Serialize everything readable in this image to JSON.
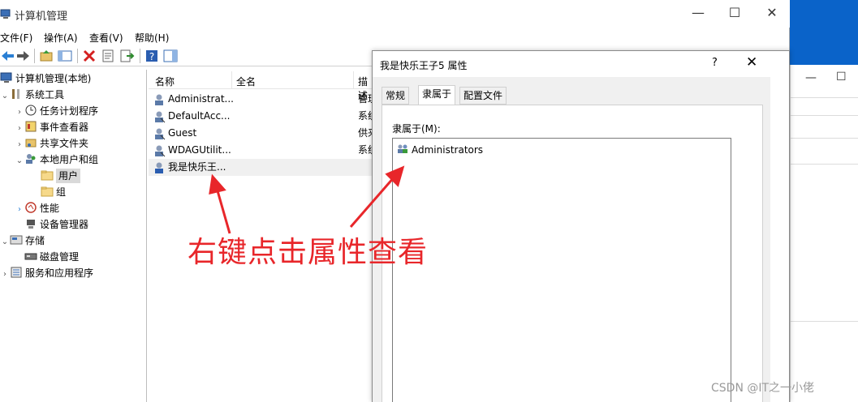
{
  "window": {
    "title": "计算机管理",
    "controls": {
      "minimize": "—",
      "maximize": "☐",
      "close": "✕"
    }
  },
  "menu": [
    "文件(F)",
    "操作(A)",
    "查看(V)",
    "帮助(H)"
  ],
  "toolbar_icons": [
    "back-icon",
    "forward-icon",
    "up-folder-icon",
    "show-hide-tree-icon",
    "delete-icon",
    "properties-icon",
    "export-icon",
    "help-icon",
    "action-pane-icon"
  ],
  "tree": [
    {
      "label": "计算机管理(本地)",
      "icon": "computer-management-icon",
      "expand": "",
      "level": 0
    },
    {
      "label": "系统工具",
      "icon": "system-tools-icon",
      "expand": "⌄",
      "level": 1
    },
    {
      "label": "任务计划程序",
      "icon": "task-scheduler-icon",
      "expand": "›",
      "level": 2
    },
    {
      "label": "事件查看器",
      "icon": "event-viewer-icon",
      "expand": "›",
      "level": 2
    },
    {
      "label": "共享文件夹",
      "icon": "shared-folders-icon",
      "expand": "›",
      "level": 2
    },
    {
      "label": "本地用户和组",
      "icon": "local-users-groups-icon",
      "expand": "⌄",
      "level": 2
    },
    {
      "label": "用户",
      "icon": "folder-icon",
      "expand": "",
      "level": 3,
      "selected": true
    },
    {
      "label": "组",
      "icon": "folder-icon",
      "expand": "",
      "level": 3
    },
    {
      "label": "性能",
      "icon": "performance-icon",
      "expand": "›",
      "level": 2
    },
    {
      "label": "设备管理器",
      "icon": "device-manager-icon",
      "expand": "",
      "level": 2
    },
    {
      "label": "存储",
      "icon": "storage-icon",
      "expand": "⌄",
      "level": 1
    },
    {
      "label": "磁盘管理",
      "icon": "disk-management-icon",
      "expand": "",
      "level": 2
    },
    {
      "label": "服务和应用程序",
      "icon": "services-apps-icon",
      "expand": "›",
      "level": 1
    }
  ],
  "list": {
    "columns": [
      "名称",
      "全名",
      "描述"
    ],
    "rows": [
      {
        "name": "Administrat...",
        "desc": "管理"
      },
      {
        "name": "DefaultAcc...",
        "desc": "系统"
      },
      {
        "name": "Guest",
        "desc": "供来"
      },
      {
        "name": "WDAGUtilit...",
        "desc": "系统"
      },
      {
        "name": "我是快乐王...",
        "desc": "",
        "selected": true
      }
    ]
  },
  "dialog": {
    "title": "我是快乐王子5 属性",
    "help": "?",
    "close": "✕",
    "tabs": [
      "常规",
      "隶属于",
      "配置文件"
    ],
    "active_tab": 1,
    "member_label": "隶属于(M):",
    "members": [
      "Administrators"
    ]
  },
  "annotation": "右键点击属性查看",
  "watermark": "CSDN @IT之一小佬",
  "colors": {
    "annotation": "#e8262a",
    "desktop": "#0a63c9",
    "action_header": "#c9d8ea"
  }
}
